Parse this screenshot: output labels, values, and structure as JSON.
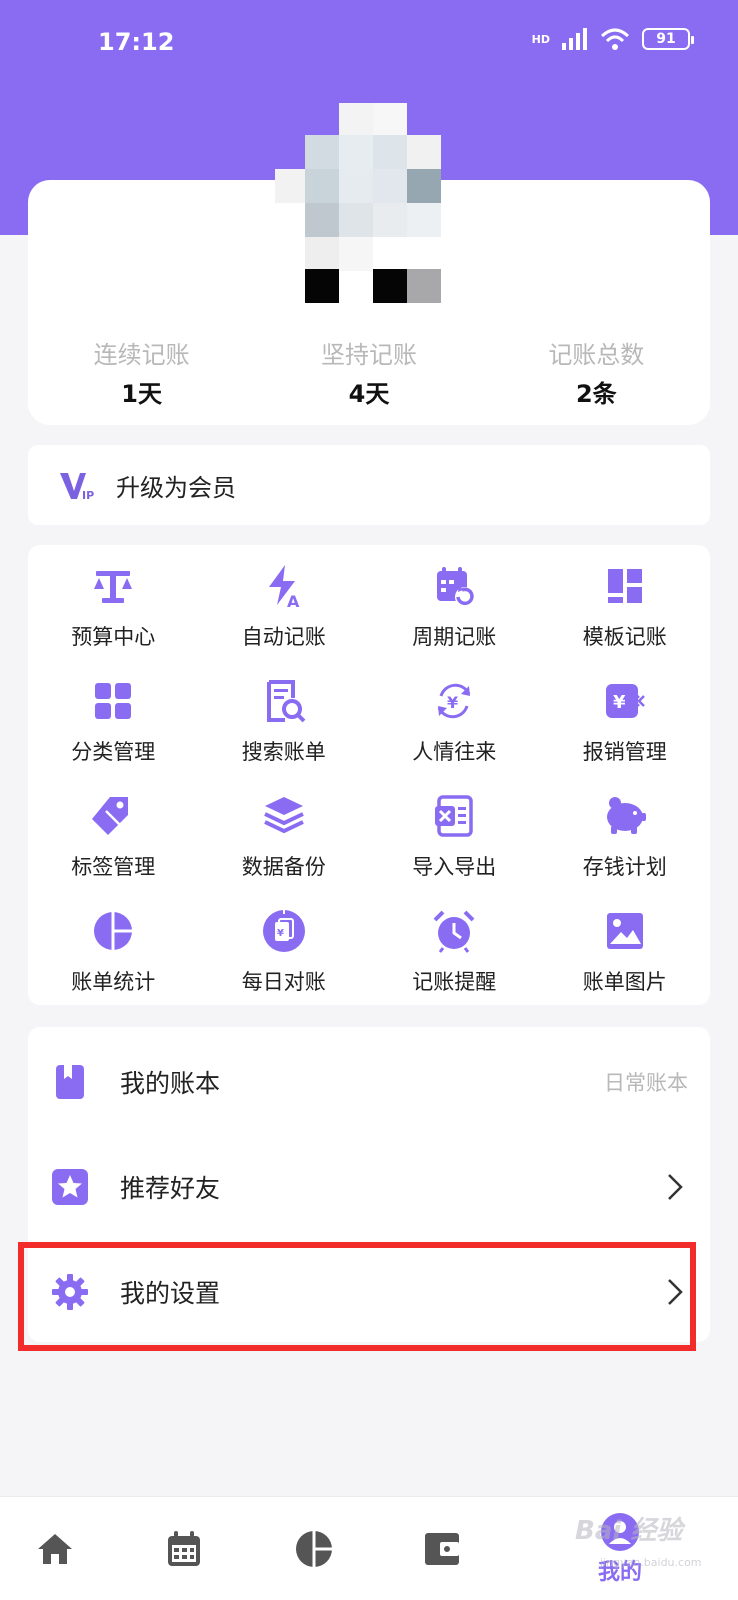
{
  "status_bar": {
    "time": "17:12",
    "network": "HD",
    "battery": "91"
  },
  "stats": [
    {
      "label": "连续记账",
      "value": "1天"
    },
    {
      "label": "坚持记账",
      "value": "4天"
    },
    {
      "label": "记账总数",
      "value": "2条"
    }
  ],
  "vip": {
    "label": "升级为会员",
    "icon": "vip-icon"
  },
  "features": [
    {
      "label": "预算中心",
      "icon": "scale-icon"
    },
    {
      "label": "自动记账",
      "icon": "lightning-icon"
    },
    {
      "label": "周期记账",
      "icon": "calendar-cycle-icon"
    },
    {
      "label": "模板记账",
      "icon": "template-icon"
    },
    {
      "label": "分类管理",
      "icon": "category-grid-icon"
    },
    {
      "label": "搜索账单",
      "icon": "search-bill-icon"
    },
    {
      "label": "人情往来",
      "icon": "exchange-icon"
    },
    {
      "label": "报销管理",
      "icon": "reimburse-icon"
    },
    {
      "label": "标签管理",
      "icon": "tag-icon"
    },
    {
      "label": "数据备份",
      "icon": "layers-icon"
    },
    {
      "label": "导入导出",
      "icon": "excel-icon"
    },
    {
      "label": "存钱计划",
      "icon": "piggy-bank-icon"
    },
    {
      "label": "账单统计",
      "icon": "pie-chart-icon"
    },
    {
      "label": "每日对账",
      "icon": "daily-check-icon"
    },
    {
      "label": "记账提醒",
      "icon": "alarm-clock-icon"
    },
    {
      "label": "账单图片",
      "icon": "image-icon"
    }
  ],
  "list": {
    "ledger": {
      "label": "我的账本",
      "value": "日常账本",
      "icon": "book-icon"
    },
    "recommend": {
      "label": "推荐好友",
      "icon": "star-icon"
    },
    "settings": {
      "label": "我的设置",
      "icon": "gear-icon"
    }
  },
  "bottom_nav": {
    "active_label": "我的",
    "items": [
      "home-icon",
      "calendar-icon",
      "pie-chart-icon",
      "wallet-icon",
      "profile-icon"
    ]
  },
  "watermark": {
    "text": "Bai 经验",
    "sub": "jingyan.baidu.com"
  },
  "colors": {
    "accent": "#8a6cf2",
    "highlight": "#f22b2b",
    "background": "#f5f5f7"
  }
}
